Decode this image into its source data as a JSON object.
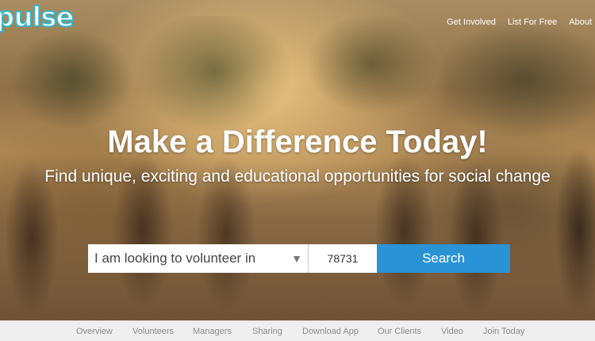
{
  "brand": {
    "logo_text": "pulse",
    "accent": "#35b5c9"
  },
  "topnav": {
    "items": [
      "Get Involved",
      "List For Free",
      "About"
    ]
  },
  "hero": {
    "headline": "Make a Difference Today!",
    "subheadline": "Find unique, exciting and educational opportunities for social change"
  },
  "search": {
    "select_value": "I am looking to volunteer in",
    "zip_value": "78731",
    "button_label": "Search",
    "button_color": "#2a93d5",
    "dropdown_icon": "triangle-down-icon"
  },
  "subnav": {
    "items": [
      "Overview",
      "Volunteers",
      "Managers",
      "Sharing",
      "Download App",
      "Our Clients",
      "Video",
      "Join Today"
    ]
  }
}
